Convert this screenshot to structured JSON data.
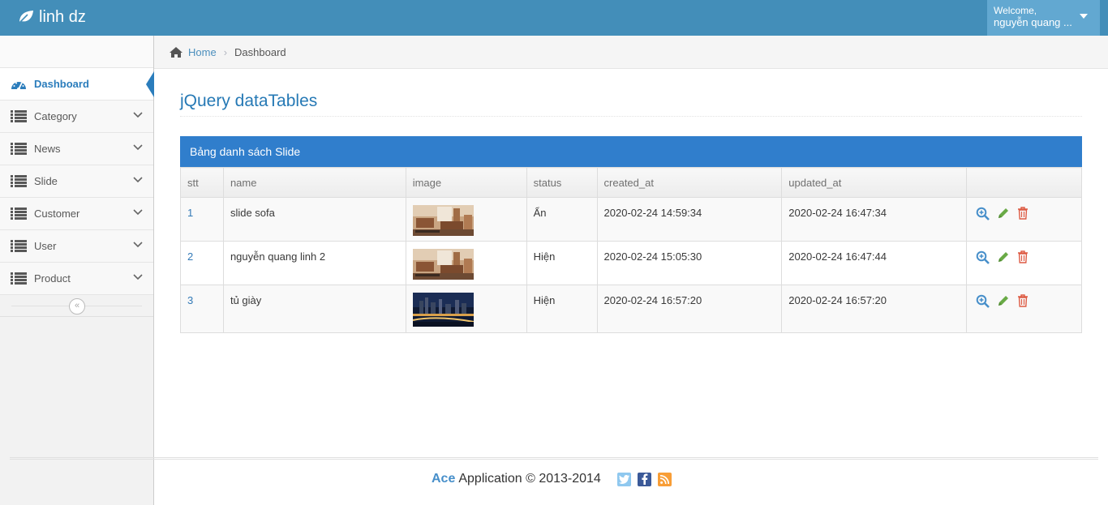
{
  "navbar": {
    "brand": "linh dz",
    "welcome": "Welcome,",
    "user_name": "nguyễn quang ..."
  },
  "sidebar": {
    "items": [
      {
        "label": "Dashboard",
        "icon": "tachometer-icon"
      },
      {
        "label": "Category",
        "icon": "list-icon"
      },
      {
        "label": "News",
        "icon": "list-icon"
      },
      {
        "label": "Slide",
        "icon": "list-icon"
      },
      {
        "label": "Customer",
        "icon": "list-icon"
      },
      {
        "label": "User",
        "icon": "list-icon"
      },
      {
        "label": "Product",
        "icon": "list-icon"
      }
    ],
    "collapse_glyph": "«"
  },
  "breadcrumb": {
    "home": "Home",
    "separator": "›",
    "current": "Dashboard"
  },
  "page": {
    "title": "jQuery dataTables"
  },
  "table": {
    "caption": "Bảng danh sách Slide",
    "columns": [
      "stt",
      "name",
      "image",
      "status",
      "created_at",
      "updated_at",
      ""
    ],
    "rows": [
      {
        "stt": "1",
        "name": "slide sofa",
        "image": "living-room-thumbnail",
        "status": "Ẩn",
        "created_at": "2020-02-24 14:59:34",
        "updated_at": "2020-02-24 16:47:34"
      },
      {
        "stt": "2",
        "name": "nguyễn quang linh 2",
        "image": "living-room-thumbnail",
        "status": "Hiện",
        "created_at": "2020-02-24 15:05:30",
        "updated_at": "2020-02-24 16:47:44"
      },
      {
        "stt": "3",
        "name": "tủ giày",
        "image": "city-night-thumbnail",
        "status": "Hiện",
        "created_at": "2020-02-24 16:57:20",
        "updated_at": "2020-02-24 16:57:20"
      }
    ],
    "action_icons": [
      "zoom-in-icon",
      "pencil-icon",
      "trash-icon"
    ]
  },
  "footer": {
    "brand": "Ace",
    "text": "Application © 2013-2014",
    "socials": [
      "twitter-icon",
      "facebook-icon",
      "rss-icon"
    ]
  },
  "colors": {
    "navbar": "#438eb9",
    "user_menu": "#62a8d1",
    "accent": "#2b7dbc",
    "table_header": "#307ecc",
    "zoom": "#478fca",
    "edit": "#69aa46",
    "delete": "#dd5a43"
  }
}
